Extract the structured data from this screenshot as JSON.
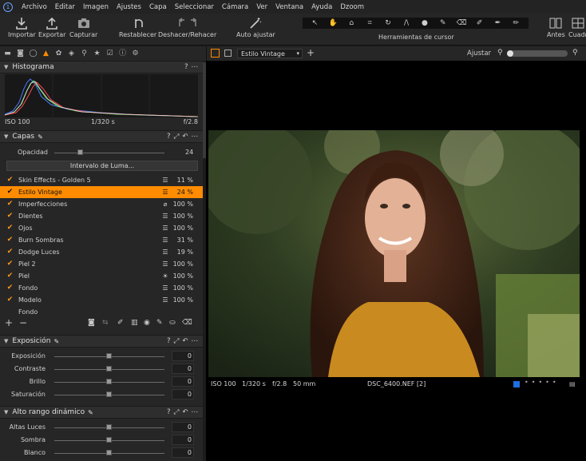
{
  "menu": {
    "items": [
      "Archivo",
      "Editar",
      "Imagen",
      "Ajustes",
      "Capa",
      "Seleccionar",
      "Cámara",
      "Ver",
      "Ventana",
      "Ayuda",
      "Dzoom"
    ]
  },
  "toolbar": {
    "importar": "Importar",
    "exportar": "Exportar",
    "capturar": "Capturar",
    "restablecer": "Restablecer",
    "deshacer": "Deshacer/Rehacer",
    "auto": "Auto ajustar",
    "cursor_tools": "Herramientas de cursor",
    "antes": "Antes",
    "cuadricula": "Cuadr"
  },
  "viewbar": {
    "style_select": "Estilo Vintage",
    "ajustar": "Ajustar"
  },
  "histogram": {
    "title": "Histograma",
    "iso": "ISO 100",
    "shutter": "1/320 s",
    "aperture": "f/2.8"
  },
  "layers": {
    "title": "Capas",
    "opacity_label": "Opacidad",
    "opacity_value": "24",
    "opacity_fraction": 0.24,
    "luma_button": "Intervalo de Luma...",
    "items": [
      {
        "name": "Skin Effects - Golden 5",
        "pct": "11 %",
        "checked": true,
        "icon": "sliders"
      },
      {
        "name": "Estilo Vintage",
        "pct": "24 %",
        "checked": true,
        "icon": "sliders",
        "selected": true
      },
      {
        "name": "Imperfecciones",
        "pct": "100 %",
        "checked": true,
        "icon": "bandage"
      },
      {
        "name": "Dientes",
        "pct": "100 %",
        "checked": true,
        "icon": "sliders"
      },
      {
        "name": "Ojos",
        "pct": "100 %",
        "checked": true,
        "icon": "sliders"
      },
      {
        "name": "Burn Sombras",
        "pct": "31 %",
        "checked": true,
        "icon": "sliders"
      },
      {
        "name": "Dodge Luces",
        "pct": "19 %",
        "checked": true,
        "icon": "sliders"
      },
      {
        "name": "Piel 2",
        "pct": "100 %",
        "checked": true,
        "icon": "sliders"
      },
      {
        "name": "Piel",
        "pct": "100 %",
        "checked": true,
        "icon": "sun"
      },
      {
        "name": "Fondo",
        "pct": "100 %",
        "checked": true,
        "icon": "sliders"
      },
      {
        "name": "Modelo",
        "pct": "100 %",
        "checked": true,
        "icon": "sliders"
      },
      {
        "name": "Fondo",
        "pct": "",
        "checked": false,
        "icon": ""
      }
    ]
  },
  "exposure": {
    "title": "Exposición",
    "rows": [
      {
        "label": "Exposición",
        "value": "0"
      },
      {
        "label": "Contraste",
        "value": "0"
      },
      {
        "label": "Brillo",
        "value": "0"
      },
      {
        "label": "Saturación",
        "value": "0"
      }
    ]
  },
  "hdr": {
    "title": "Alto rango dinámico",
    "rows": [
      {
        "label": "Altas Luces",
        "value": "0"
      },
      {
        "label": "Sombra",
        "value": "0"
      },
      {
        "label": "Blanco",
        "value": "0"
      }
    ]
  },
  "infobar": {
    "iso": "ISO 100",
    "shutter": "1/320 s",
    "aperture": "f/2.8",
    "focal": "50 mm",
    "filename": "DSC_6400.NEF [2]"
  },
  "colors": {
    "accent": "#ff8c00",
    "panel": "#262626"
  }
}
